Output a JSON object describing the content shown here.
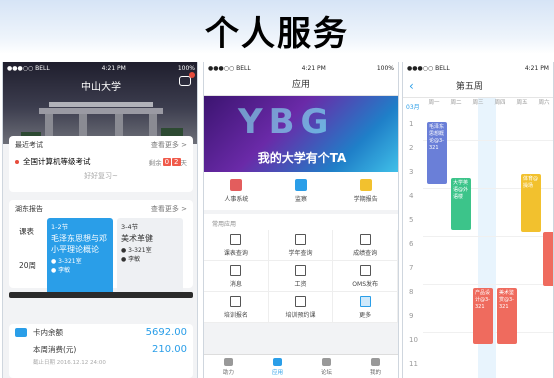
{
  "banner": {
    "title": "个人服务"
  },
  "phone1": {
    "status": {
      "carrier": "●●●○○ BELL",
      "time": "4:21 PM",
      "battery": "100%"
    },
    "header_title": "中山大学",
    "exam": {
      "section": "最近考试",
      "more": "查看更多 >",
      "item": "全国计算机等级考试",
      "remain_label": "剩余",
      "days": [
        "0",
        "2"
      ],
      "unit": "天",
      "note": "好好复习~"
    },
    "schedule": {
      "section": "湖东报告",
      "more": "查看更多 >",
      "day": "课表",
      "date": "20周",
      "courses": [
        {
          "period": "1-2节",
          "name": "毛泽东思想与邓小平理论概论",
          "room": "3-321室",
          "teacher": "李敏"
        },
        {
          "period": "3-4节",
          "name": "美术革健",
          "room": "3-321室",
          "teacher": "李敏"
        }
      ]
    },
    "card": {
      "balance_label": "卡内余额",
      "balance": "5692.00",
      "spend_label": "本周消费(元)",
      "spend": "210.00",
      "updated": "截止日期 2016.12.12 24:00"
    }
  },
  "phone2": {
    "status": {
      "carrier": "●●●○○ BELL",
      "time": "4:21 PM",
      "battery": "100%"
    },
    "title": "应用",
    "ad": {
      "logo": "YBG",
      "slogan": "我的大学有个TA"
    },
    "quick": [
      "人事系统",
      "监察",
      "学期报告"
    ],
    "section": "常用应用",
    "apps": [
      "课表查询",
      "学年查询",
      "成绩查询",
      "消息",
      "工资",
      "OMS发布",
      "培训报名",
      "培训预约课",
      "更多"
    ],
    "tabs": [
      "助力",
      "应用",
      "论坛",
      "我的"
    ]
  },
  "phone3": {
    "status": {
      "carrier": "●●●○○ BELL",
      "time": "4:21 PM"
    },
    "week": "第五周",
    "month": "03月",
    "days": [
      "周一",
      "周二",
      "周三",
      "周四",
      "周五",
      "周六"
    ],
    "hours": [
      "1",
      "2",
      "3",
      "4",
      "5",
      "6",
      "7",
      "8",
      "9",
      "10",
      "11"
    ],
    "events": [
      {
        "text": "毛泽东思想概论@3-321",
        "color": "#6a7fd8"
      },
      {
        "text": "大学英语@外语楼",
        "color": "#3cc48a"
      },
      {
        "text": "体育@操场",
        "color": "#f2c12e"
      },
      {
        "text": "产品设计@3-321",
        "color": "#ef6b5e"
      },
      {
        "text": "美术鉴赏@3-321",
        "color": "#ef6b5e"
      }
    ]
  }
}
